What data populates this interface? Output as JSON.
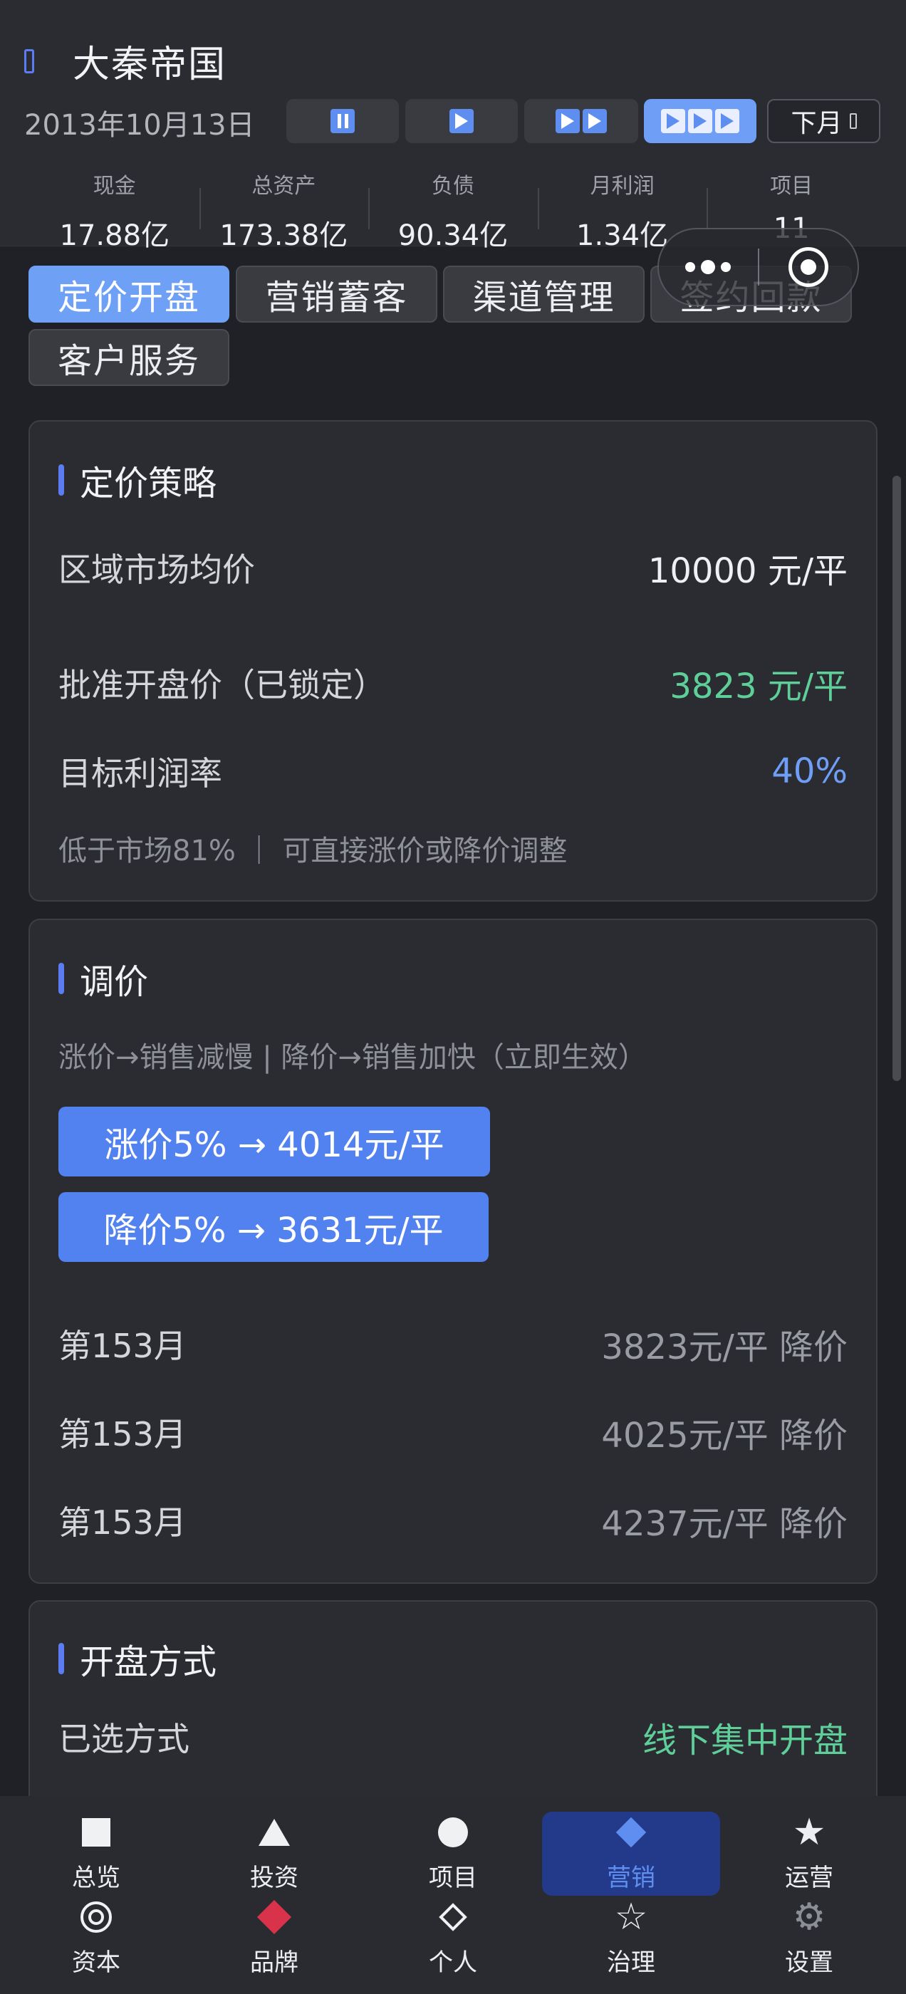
{
  "header": {
    "title": "大秦帝国",
    "date": "2013年10月13日",
    "next_label": "下月",
    "speeds": [
      "pause",
      "play",
      "fast",
      "fastest"
    ],
    "active_speed": "fastest"
  },
  "stats": [
    {
      "label": "现金",
      "value": "17.88亿"
    },
    {
      "label": "总资产",
      "value": "173.38亿"
    },
    {
      "label": "负债",
      "value": "90.34亿"
    },
    {
      "label": "月利润",
      "value": "1.34亿"
    },
    {
      "label": "项目",
      "value": "11"
    }
  ],
  "tabs": [
    "定价开盘",
    "营销蓄客",
    "渠道管理",
    "签约回款",
    "客户服务"
  ],
  "active_tab": "定价开盘",
  "pricing": {
    "title": "定价策略",
    "market_label": "区域市场均价",
    "market_value": "10000 元/平",
    "approved_label": "批准开盘价（已锁定）",
    "approved_value": "3823 元/平",
    "margin_label": "目标利润率",
    "margin_value": "40%",
    "note": "低于市场81% ｜ 可直接涨价或降价调整"
  },
  "adjust": {
    "title": "调价",
    "hint": "涨价→销售减慢 | 降价→销售加快（立即生效）",
    "raise_btn": "涨价5% → 4014元/平",
    "cut_btn": "降价5% → 3631元/平",
    "history": [
      {
        "month": "第153月",
        "detail": "3823元/平 降价"
      },
      {
        "month": "第153月",
        "detail": "4025元/平 降价"
      },
      {
        "month": "第153月",
        "detail": "4237元/平 降价"
      }
    ]
  },
  "opening": {
    "title": "开盘方式",
    "selected_label": "已选方式",
    "selected_value": "线下集中开盘"
  },
  "nav": [
    {
      "label": "总览",
      "icon": "square-icon"
    },
    {
      "label": "投资",
      "icon": "triangle-icon"
    },
    {
      "label": "项目",
      "icon": "circle-icon"
    },
    {
      "label": "营销",
      "icon": "diamond-icon"
    },
    {
      "label": "运营",
      "icon": "star-icon"
    },
    {
      "label": "资本",
      "icon": "target-icon"
    },
    {
      "label": "品牌",
      "icon": "red-diamond-icon"
    },
    {
      "label": "个人",
      "icon": "outline-diamond-icon"
    },
    {
      "label": "治理",
      "icon": "outline-star-icon"
    },
    {
      "label": "设置",
      "icon": "gear-icon"
    }
  ],
  "colors": {
    "accent": "#6ea0f6",
    "button": "#5282f0",
    "positive": "#5fcf9a",
    "highlight_nav": "#233a8a",
    "brand_red": "#d8334a"
  }
}
